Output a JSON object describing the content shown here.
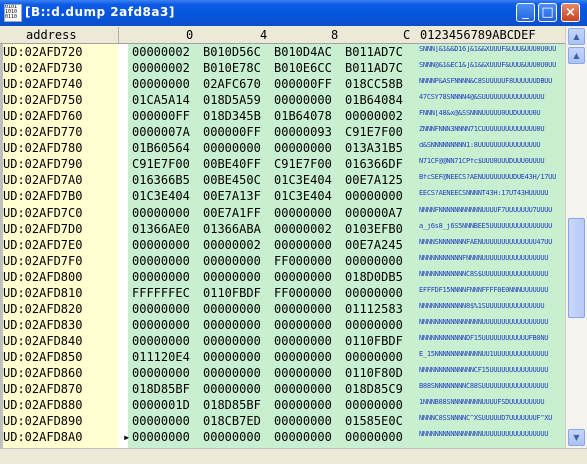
{
  "window": {
    "title": "[B::d.dump 2afd8a3]",
    "minimize_glyph": "_",
    "maximize_glyph": "□",
    "close_glyph": "×"
  },
  "header": {
    "address": "address",
    "col0": "0",
    "col4": "4",
    "col8": "8",
    "colC": "C",
    "ascii": "0123456789ABCDEF"
  },
  "scrollbar": {
    "up_glyph": "▲",
    "down_glyph": "▼"
  },
  "rows": [
    {
      "addr": "UD:02AFD720",
      "mark": "",
      "d": [
        "00000002",
        "B010D56C",
        "B010D4AC",
        "B011AD7C"
      ],
      "asc": "SNNN]&1&&D16]&1&&XUUUF&UUU&UUU0U0UU"
    },
    {
      "addr": "UD:02AFD730",
      "mark": "",
      "d": [
        "00000002",
        "B010E78C",
        "B010E6CC",
        "B011AD7C"
      ],
      "asc": "SNNN@&1&EC1&]&1&&XUUUF&UUU&UUU0U0UU"
    },
    {
      "addr": "UD:02AFD740",
      "mark": "",
      "d": [
        "00000000",
        "02AFC670",
        "000000FF",
        "018CC58B"
      ],
      "asc": "NNNNP&ASFNNNN&C8SUUUUUF8UUUUUUDBUU"
    },
    {
      "addr": "UD:02AFD750",
      "mark": "",
      "d": [
        "01CA5A14",
        "018D5A59",
        "00000000",
        "01B64084"
      ],
      "asc": "47CSY78SNNNN4@&SUUUUUUUUUUUUUUUU"
    },
    {
      "addr": "UD:02AFD760",
      "mark": "",
      "d": [
        "000000FF",
        "018D345B",
        "01B64078",
        "00000002"
      ],
      "asc": "FNNN[48&x@&SSNNNUUUUU0UUDUUUU0U"
    },
    {
      "addr": "UD:02AFD770",
      "mark": "",
      "d": [
        "0000007A",
        "000000FF",
        "00000093",
        "C91E7F00"
      ],
      "asc": "ZNNNFNNN3NNNN71CUUUUUUUUUUUUUU0U"
    },
    {
      "addr": "UD:02AFD780",
      "mark": "",
      "d": [
        "01B60564",
        "00000000",
        "00000000",
        "013A31B5"
      ],
      "asc": "d&SNNNNNNNNN1:8UUUUUUUUUUUUUUUU"
    },
    {
      "addr": "UD:02AFD790",
      "mark": "",
      "d": [
        "C91E7F00",
        "00BE40FF",
        "C91E7F00",
        "016366DF"
      ],
      "asc": "N71CF@@NN71CPfc$UUU0UUUDUUU0UUUU"
    },
    {
      "addr": "UD:02AFD7A0",
      "mark": "",
      "d": [
        "016366B5",
        "00BE450C",
        "01C3E404",
        "00E7A125"
      ],
      "asc": "BfcSEF@NEECS?AENUUUUUUUUDUE43H/17UU"
    },
    {
      "addr": "UD:02AFD7B0",
      "mark": "",
      "d": [
        "01C3E404",
        "00E7A13F",
        "01C3E404",
        "00000000"
      ],
      "asc": "EECS?AENEECSNNNNT43H:17UT43HUUUUU"
    },
    {
      "addr": "UD:02AFD7C0",
      "mark": "",
      "d": [
        "00000000",
        "00E7A1FF",
        "00000000",
        "000000A7"
      ],
      "asc": "NNNNFNNNNNNNNNNNUUUUF7UUUUUUU7UUUU"
    },
    {
      "addr": "UD:02AFD7D0",
      "mark": "",
      "d": [
        "01366AE0",
        "01366ABA",
        "00000002",
        "0103EFB0"
      ],
      "asc": "a_j6s8_j6S5NNNBEE5UUUUUUUUUUUUUUUU"
    },
    {
      "addr": "UD:02AFD7E0",
      "mark": "",
      "d": [
        "00000000",
        "00000002",
        "00000000",
        "00E7A245"
      ],
      "asc": "NNNNSNNNNNNNFAENUUUUUUUUUUUUUU47UU"
    },
    {
      "addr": "UD:02AFD7F0",
      "mark": "",
      "d": [
        "00000000",
        "00000000",
        "FF000000",
        "00000000"
      ],
      "asc": "NNNNNNNNNNNFNNNNUUUUUUUUUUUUUUUUU"
    },
    {
      "addr": "UD:02AFD800",
      "mark": "",
      "d": [
        "00000000",
        "00000000",
        "00000000",
        "018D0DB5"
      ],
      "asc": "NNNNNNNNNNNNC8S$UUUUUUUUUUUUUUUUU"
    },
    {
      "addr": "UD:02AFD810",
      "mark": "",
      "d": [
        "FFFFFFEC",
        "0110FBDF",
        "FF000000",
        "00000000"
      ],
      "asc": "EFFFDF15NNNNFNNNFFFF0E0NNNUUUUUUU"
    },
    {
      "addr": "UD:02AFD820",
      "mark": "",
      "d": [
        "00000000",
        "00000000",
        "00000000",
        "01112583"
      ],
      "asc": "NNNNNNNNNNNN8$%1SUUUUUUUUUUUUUUU"
    },
    {
      "addr": "UD:02AFD830",
      "mark": "",
      "d": [
        "00000000",
        "00000000",
        "00000000",
        "00000000"
      ],
      "asc": "NNNNNNNNNNNNNNNNUUUUUUUUUUUUUUUUU"
    },
    {
      "addr": "UD:02AFD840",
      "mark": "",
      "d": [
        "00000000",
        "00000000",
        "00000000",
        "0110FBDF"
      ],
      "asc": "NNNNNNNNNNNNDF15UUUUUUUUUUUUFB0NU"
    },
    {
      "addr": "UD:02AFD850",
      "mark": "",
      "d": [
        "011120E4",
        "00000000",
        "00000000",
        "00000000"
      ],
      "asc": "E_15NNNNNNNNNNNNUU1UUUUUUUUUUUUUU"
    },
    {
      "addr": "UD:02AFD860",
      "mark": "",
      "d": [
        "00000000",
        "00000000",
        "00000000",
        "0110F80D"
      ],
      "asc": "NNNNNNNNNNNNNNCF15UUUUUUUUUUUUUUU"
    },
    {
      "addr": "UD:02AFD870",
      "mark": "",
      "d": [
        "018D85BF",
        "00000000",
        "00000000",
        "018D85C9"
      ],
      "asc": "B88SNNNNNNNNC88SUUUUUUUUUUUUUUUUU"
    },
    {
      "addr": "UD:02AFD880",
      "mark": "",
      "d": [
        "0000001D",
        "018D85BF",
        "00000000",
        "00000000"
      ],
      "asc": "1NNNB88SNNNNNNNNUUUUFSDUUUUUUUUU"
    },
    {
      "addr": "UD:02AFD890",
      "mark": "",
      "d": [
        "00000000",
        "018CB7ED",
        "00000000",
        "01585E0C"
      ],
      "asc": "NNNNC8SSNNNNC^XSUUUUUD7UUUUUUUF^XU"
    },
    {
      "addr": "UD:02AFD8A0",
      "mark": "▸",
      "d": [
        "00000000",
        "00000000",
        "00000000",
        "00000000"
      ],
      "asc": "NNNNNNNNNNNNNNNNUUUUUUUUUUUUUUUUU"
    }
  ]
}
